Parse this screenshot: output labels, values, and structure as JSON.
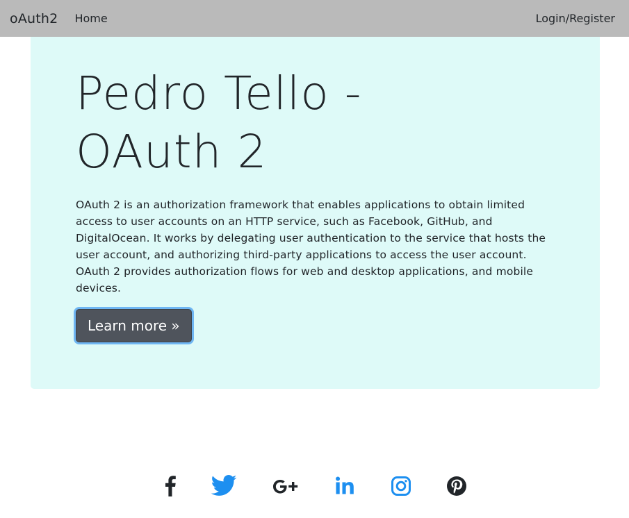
{
  "navbar": {
    "brand": "oAuth2",
    "home_label": "Home",
    "login_label": "Login/Register"
  },
  "hero": {
    "title": "Pedro Tello - OAuth 2",
    "description": "OAuth 2 is an authorization framework that enables applications to obtain limited access to user accounts on an HTTP service, such as Facebook, GitHub, and DigitalOcean. It works by delegating user authentication to the service that hosts the user account, and authorizing third-party applications to access the user account. OAuth 2 provides authorization flows for web and desktop applications, and mobile devices.",
    "button_label": "Learn more »"
  },
  "social": [
    {
      "icon": "facebook-icon",
      "color": "#212529"
    },
    {
      "icon": "twitter-icon",
      "color": "#1d8ff0"
    },
    {
      "icon": "google-plus-icon",
      "color": "#212529"
    },
    {
      "icon": "linkedin-icon",
      "color": "#1d8ff0"
    },
    {
      "icon": "instagram-icon",
      "color": "#1d8ff0"
    },
    {
      "icon": "pinterest-icon",
      "color": "#212529"
    }
  ],
  "colors": {
    "navbar_bg": "#bababa",
    "hero_bg": "#defaf8",
    "button_bg": "#4f545c",
    "button_focus": "#6fb6f3",
    "accent_blue": "#1d8ff0"
  }
}
